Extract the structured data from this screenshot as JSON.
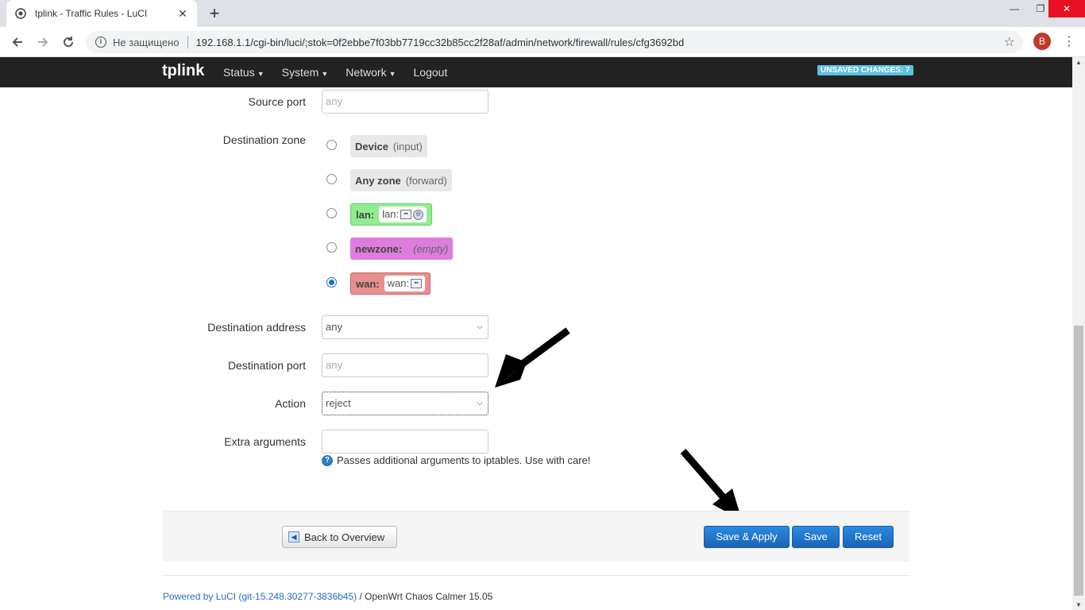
{
  "browser": {
    "tab_title": "tplink - Traffic Rules - LuCI",
    "tab_close": "✕",
    "new_tab": "+",
    "not_secure": "Не защищено",
    "url": "192.168.1.1/cgi-bin/luci/;stok=0f2ebbe7f03bb7719cc32b85cc2f28af/admin/network/firewall/rules/cfg3692bd",
    "profile_initial": "B",
    "window_controls": {
      "minimize": "—",
      "restore": "❐",
      "close": "✕"
    }
  },
  "header": {
    "brand": "tplink",
    "nav": [
      {
        "label": "Status"
      },
      {
        "label": "System"
      },
      {
        "label": "Network"
      },
      {
        "label": "Logout"
      }
    ],
    "unsaved": "UNSAVED CHANGES: 7"
  },
  "form": {
    "source_port": {
      "label": "Source port",
      "placeholder": "any"
    },
    "destination_zone": {
      "label": "Destination zone",
      "options": [
        {
          "name": "Device",
          "sub": "(input)",
          "checked": false,
          "color": "#e8e8e8"
        },
        {
          "name": "Any zone",
          "sub": "(forward)",
          "checked": false,
          "color": "#e8e8e8"
        },
        {
          "name": "lan:",
          "iface": "lan:",
          "checked": false,
          "color": "#90ee90"
        },
        {
          "name": "newzone:",
          "sub": "(empty)",
          "checked": false,
          "color": "#dd7ddd"
        },
        {
          "name": "wan:",
          "iface": "wan:",
          "checked": true,
          "color": "#e88f8f"
        }
      ]
    },
    "destination_address": {
      "label": "Destination address",
      "value": "any"
    },
    "destination_port": {
      "label": "Destination port",
      "placeholder": "any"
    },
    "action": {
      "label": "Action",
      "value": "reject"
    },
    "extra_arguments": {
      "label": "Extra arguments",
      "value": "",
      "help": "Passes additional arguments to iptables. Use with care!"
    }
  },
  "buttons": {
    "back": "Back to Overview",
    "save_apply": "Save & Apply",
    "save": "Save",
    "reset": "Reset"
  },
  "footer": {
    "powered_link": "Powered by LuCI (git-15.248.30277-3836b45)",
    "powered_rest": " / OpenWrt Chaos Calmer 15.05"
  }
}
